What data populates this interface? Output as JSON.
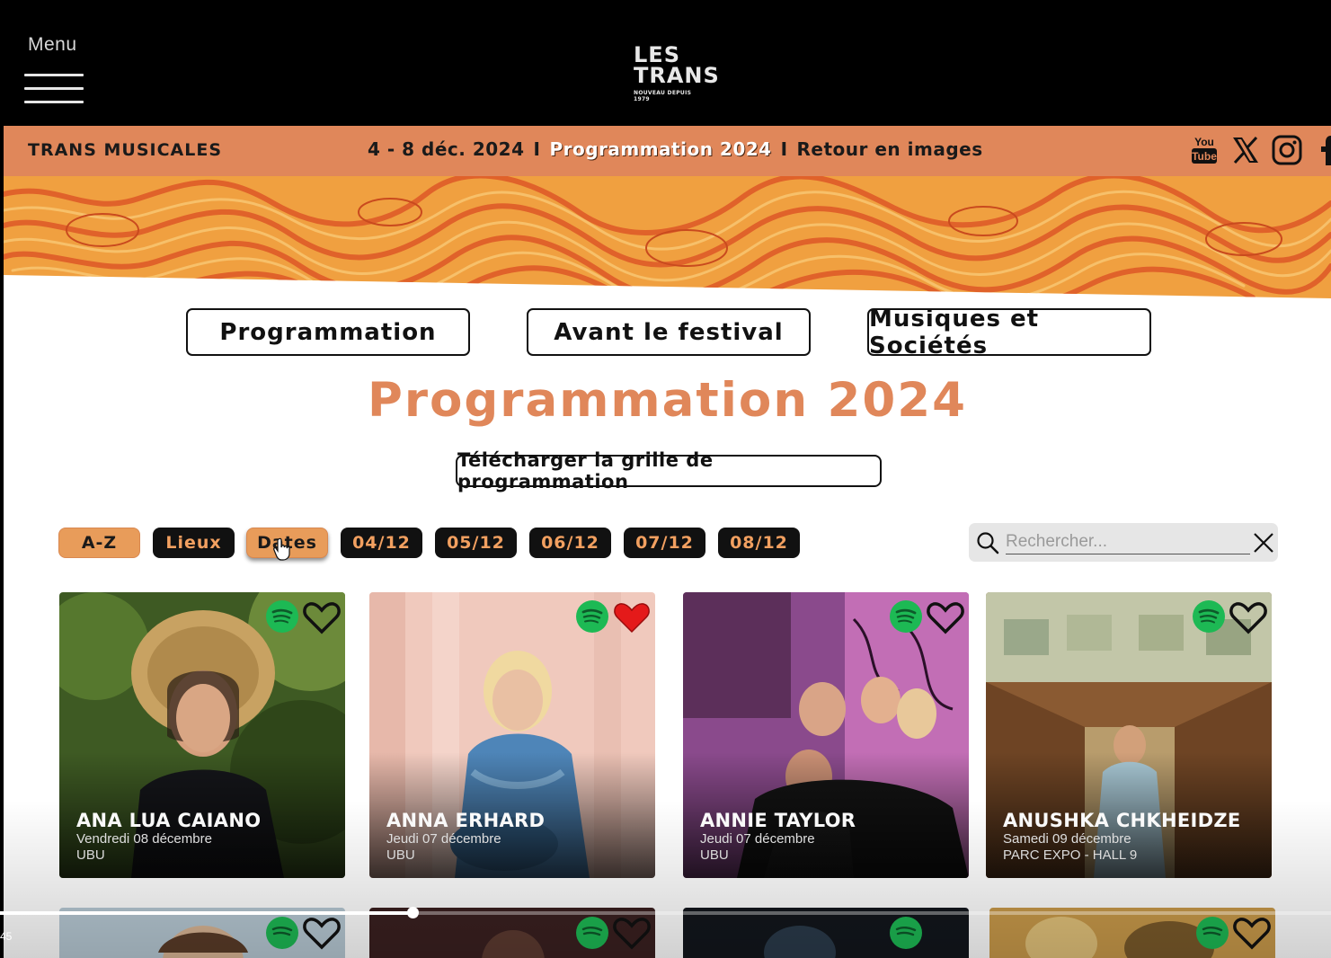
{
  "header": {
    "menu_label": "Menu",
    "logo_line1": "LES",
    "logo_line2": "TRANS",
    "logo_tagline": "NOUVEAU DEPUIS 1979"
  },
  "orange_bar": {
    "site_name": "TRANS MUSICALES",
    "dates": "4 - 8 déc. 2024",
    "separator": "I",
    "programmation_link": "Programmation 2024",
    "retour_link": "Retour en images",
    "socials": [
      "youtube-icon",
      "x-icon",
      "instagram-icon",
      "facebook-icon"
    ],
    "youtube_text_top": "You",
    "youtube_text_bottom": "Tube"
  },
  "tabs": [
    "Programmation",
    "Avant le festival",
    "Musiques et Sociétés"
  ],
  "page_title": "Programmation 2024",
  "download_label": "Télécharger la grille de programmation",
  "filters": [
    {
      "label": "A-Z",
      "style": "orange"
    },
    {
      "label": "Lieux",
      "style": "black"
    },
    {
      "label": "Dates",
      "style": "orange",
      "selected": true
    },
    {
      "label": "04/12",
      "style": "black"
    },
    {
      "label": "05/12",
      "style": "black"
    },
    {
      "label": "06/12",
      "style": "black"
    },
    {
      "label": "07/12",
      "style": "black"
    },
    {
      "label": "08/12",
      "style": "black"
    }
  ],
  "search": {
    "placeholder": "Rechercher..."
  },
  "artists": [
    {
      "name": "ANA LUA CAIANO",
      "date": "Vendredi 08 décembre",
      "venue": "UBU",
      "favorited": false
    },
    {
      "name": "ANNA ERHARD",
      "date": "Jeudi 07 décembre",
      "venue": "UBU",
      "favorited": true
    },
    {
      "name": "ANNIE TAYLOR",
      "date": "Jeudi 07 décembre",
      "venue": "UBU",
      "favorited": false
    },
    {
      "name": "ANUSHKA CHKHEIDZE",
      "date": "Samedi 09 décembre",
      "venue": "PARC EXPO - HALL 9",
      "favorited": false
    }
  ],
  "video": {
    "timecode": "45",
    "progress": 0.31
  },
  "colors": {
    "accent": "#e0875a",
    "filter_orange": "#e89c5a",
    "spotify": "#1db954",
    "heart_active": "#e41a1a"
  }
}
